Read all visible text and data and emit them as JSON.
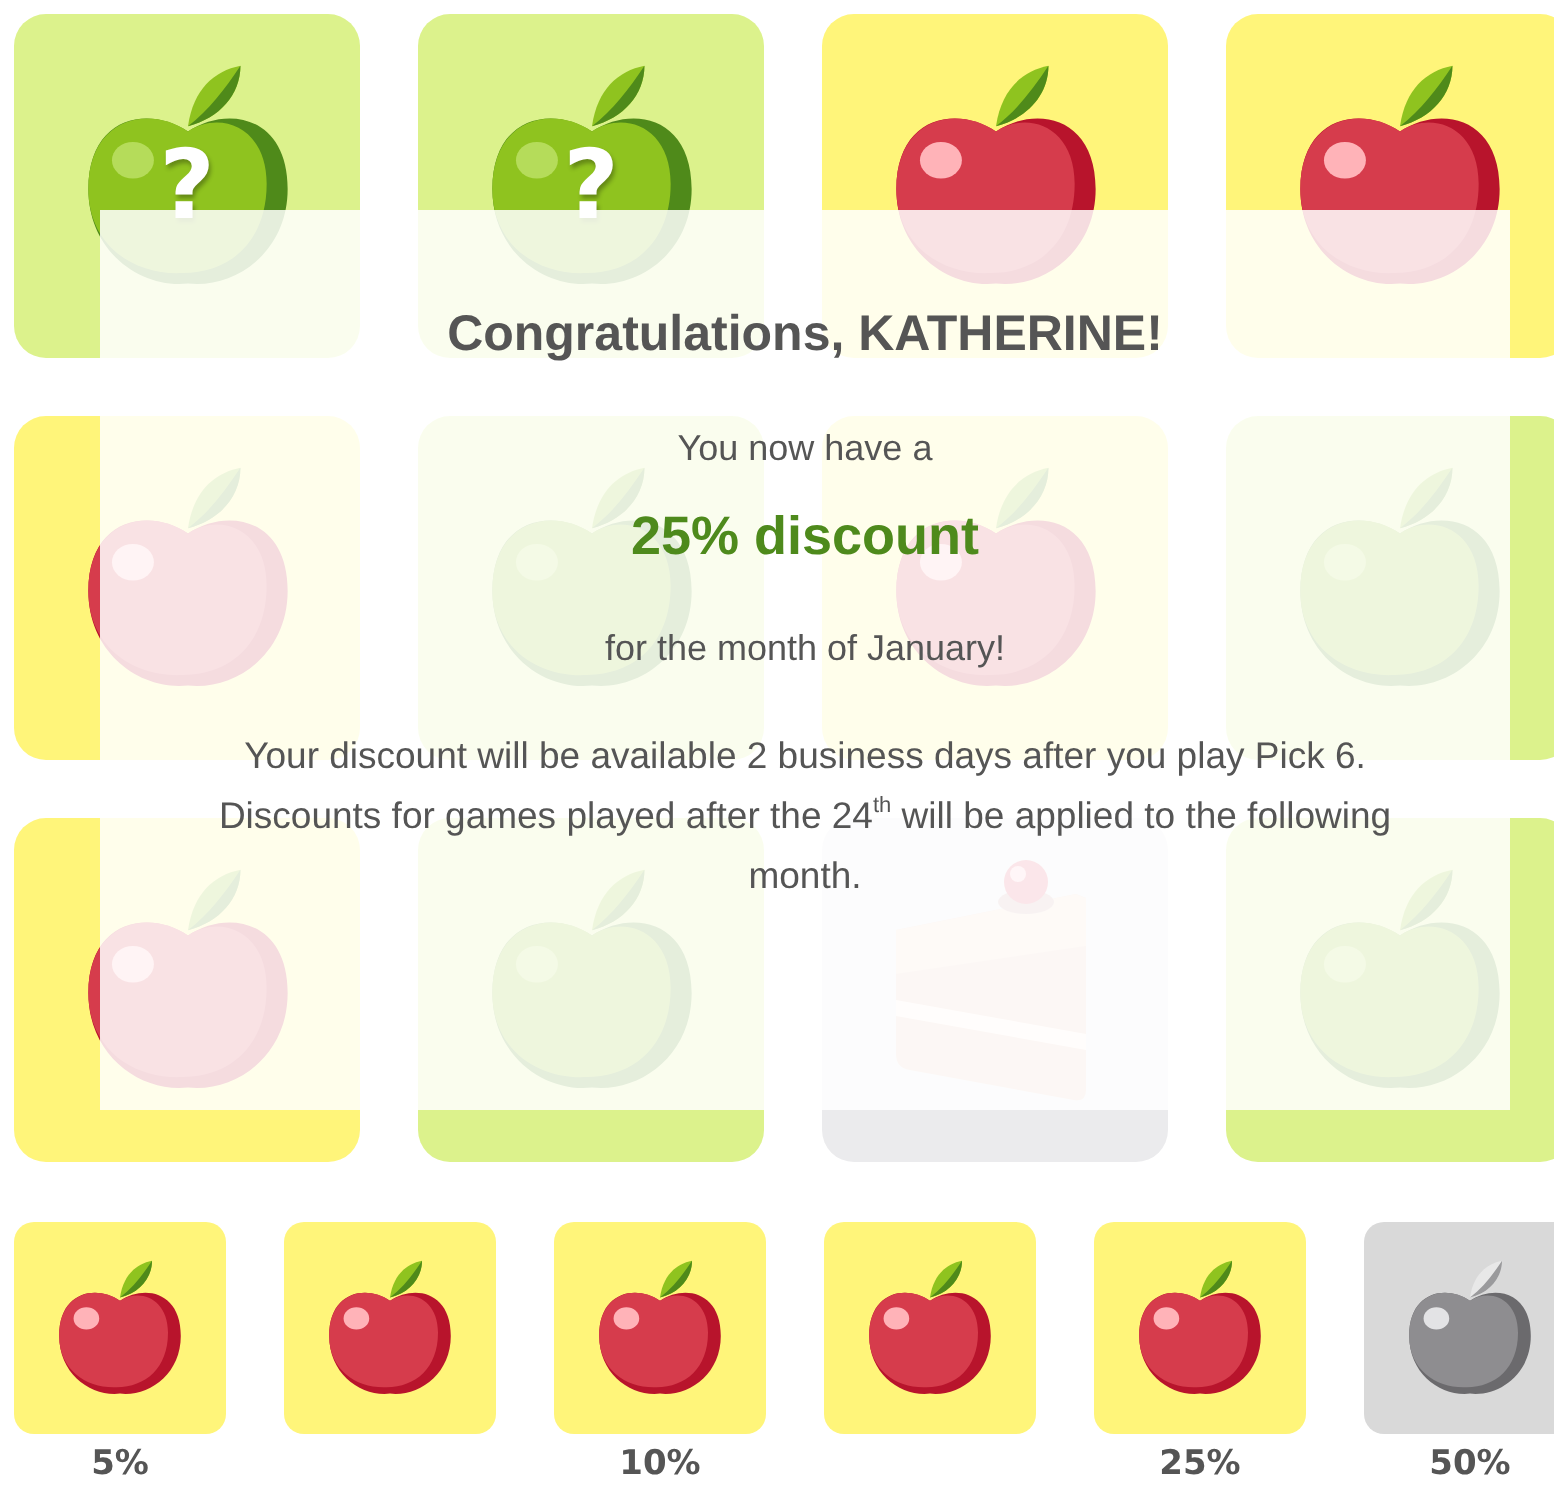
{
  "board": [
    {
      "kind": "mystery",
      "symbol": "?"
    },
    {
      "kind": "mystery",
      "symbol": "?"
    },
    {
      "kind": "apple"
    },
    {
      "kind": "apple"
    },
    {
      "kind": "apple"
    },
    {
      "kind": "mystery"
    },
    {
      "kind": "apple"
    },
    {
      "kind": "mystery"
    },
    {
      "kind": "apple"
    },
    {
      "kind": "mystery"
    },
    {
      "kind": "cake"
    },
    {
      "kind": "mystery"
    }
  ],
  "result": {
    "title": "Congratulations, KATHERINE!",
    "intro": "You now have a",
    "discount": "25% discount",
    "period": "for the month of January!",
    "notes": [
      "Your discount will be available 2 business days after you play Pick 6.",
      "Discounts for games played after the 24$^{th}$ will be applied to the following month."
    ]
  },
  "prizes": [
    {
      "earned": true,
      "label": "5%"
    },
    {
      "earned": true
    },
    {
      "earned": true,
      "label": "10%"
    },
    {
      "earned": true
    },
    {
      "earned": true,
      "label": "25%"
    },
    {
      "earned": false,
      "label": "50%"
    }
  ]
}
